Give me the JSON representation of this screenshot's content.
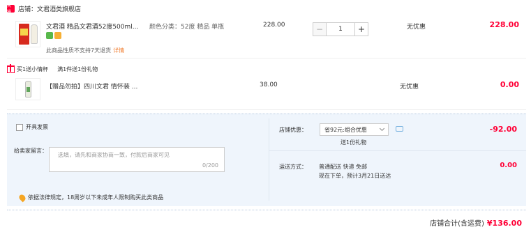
{
  "shop": {
    "badge": "天猫",
    "name": "店铺：文君酒类旗舰店"
  },
  "item": {
    "title": "文君酒 精品文君酒52度500ml...",
    "attr": "颜色分类：52度 精品 单瓶",
    "unit_price": "228.00",
    "quantity": "1",
    "discount": "无优惠",
    "subtotal": "228.00",
    "no_return": "此商品性质不支持7天退货",
    "detail_link": "详情",
    "minus": "−",
    "plus": "+"
  },
  "gift": {
    "promo": "买1送小情杯",
    "promo_sub": "满1件送1份礼物",
    "title": "【赠品勿拍】四川文君  情怀装 ...",
    "price": "38.00",
    "discount": "无优惠",
    "subtotal": "0.00"
  },
  "order": {
    "invoice_label": "开具发票",
    "message_label": "给卖家留言：",
    "message_placeholder": "选填，请先和商家协商一致，付款后商家可见",
    "message_count": "0/200",
    "law_note": "依据法律规定，18周岁以下未成年人限制购买此类商品",
    "coupon_label": "店铺优惠：",
    "coupon_value": "省92元:组合优惠",
    "coupon_gift": "送1份礼物",
    "coupon_amount": "-92.00",
    "ship_label": "运送方式：",
    "ship_line1": "普通配送  快递  免邮",
    "ship_line2": "现在下单，预计3月21日送达",
    "ship_amount": "0.00",
    "total_label": "店铺合计(含运费)",
    "total_amount": "¥136.00"
  },
  "colors": {
    "accent": "#ff0036",
    "panel_bg": "#eff5fc",
    "link_orange": "#f07c2e"
  },
  "icons": [
    "tmall-badge",
    "gift-icon",
    "chevron-down-icon",
    "chat-icon",
    "location-pin-icon",
    "checkbox"
  ]
}
